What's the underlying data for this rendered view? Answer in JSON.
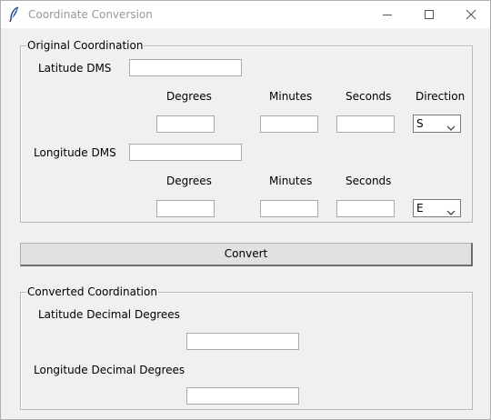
{
  "window": {
    "title": "Coordinate Conversion",
    "icon": "feather-icon"
  },
  "original": {
    "group_label": "Original Coordination",
    "latitude": {
      "label": "Latitude DMS",
      "value": "",
      "degrees_label": "Degrees",
      "minutes_label": "Minutes",
      "seconds_label": "Seconds",
      "direction_label": "Direction",
      "degrees": "",
      "minutes": "",
      "seconds": "",
      "direction": "S"
    },
    "longitude": {
      "label": "Longitude DMS",
      "value": "",
      "degrees_label": "Degrees",
      "minutes_label": "Minutes",
      "seconds_label": "Seconds",
      "degrees": "",
      "minutes": "",
      "seconds": "",
      "direction": "E"
    }
  },
  "convert_button": "Convert",
  "converted": {
    "group_label": "Converted Coordination",
    "latitude_label": "Latitude Decimal Degrees",
    "latitude_value": "",
    "longitude_label": "Longitude Decimal Degrees",
    "longitude_value": ""
  }
}
